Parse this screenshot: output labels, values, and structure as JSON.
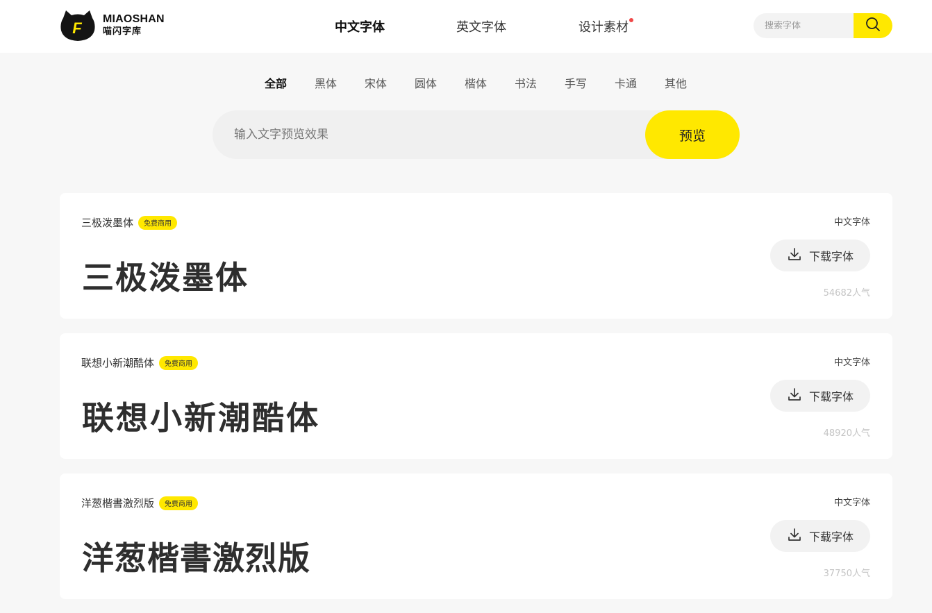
{
  "logo": {
    "en": "MIAOSHAN",
    "cn": "喵闪字库",
    "mark_letter": "F"
  },
  "nav": [
    {
      "label": "中文字体",
      "active": true
    },
    {
      "label": "英文字体",
      "active": false
    },
    {
      "label": "设计素材",
      "active": false,
      "has_dot": true
    }
  ],
  "search": {
    "placeholder": "搜索字体",
    "value": "",
    "icon": "search-icon"
  },
  "categories": [
    "全部",
    "黑体",
    "宋体",
    "圆体",
    "楷体",
    "书法",
    "手写",
    "卡通",
    "其他"
  ],
  "active_category": "全部",
  "preview": {
    "placeholder": "输入文字预览效果",
    "button_label": "预览"
  },
  "fonts": [
    {
      "name": "三极泼墨体",
      "badge": "免费商用",
      "sample": "三极泼墨体",
      "category": "中文字体",
      "download_label": "下载字体",
      "popularity": "54682人气"
    },
    {
      "name": "联想小新潮酷体",
      "badge": "免费商用",
      "sample": "联想小新潮酷体",
      "category": "中文字体",
      "download_label": "下载字体",
      "popularity": "48920人气"
    },
    {
      "name": "洋葱楷書激烈版",
      "badge": "免费商用",
      "sample": "洋葱楷書激烈版",
      "category": "中文字体",
      "download_label": "下载字体",
      "popularity": "37750人气"
    }
  ],
  "colors": {
    "accent": "#ffe800",
    "background": "#f7f7f7",
    "dot": "#f04848"
  }
}
